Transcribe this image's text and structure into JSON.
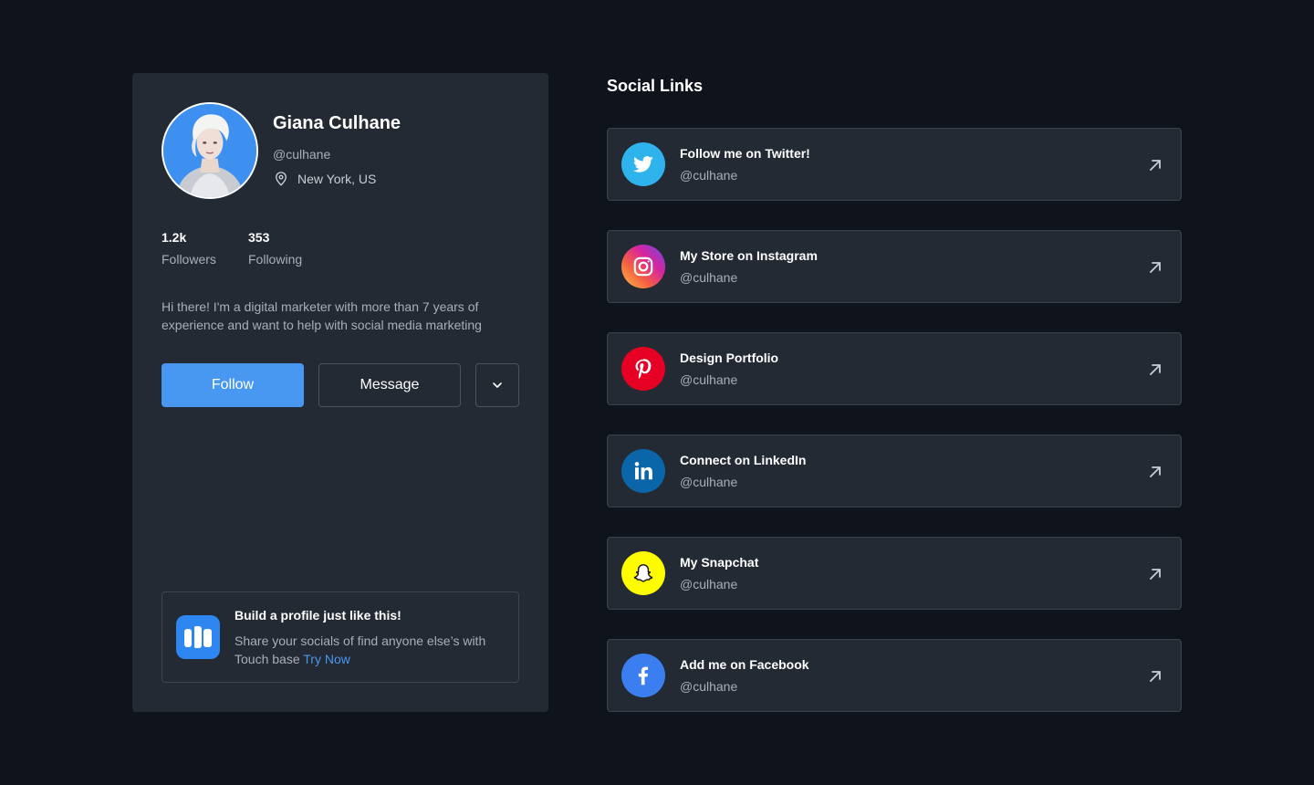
{
  "profile": {
    "name": "Giana Culhane",
    "handle": "@culhane",
    "location": "New York, US",
    "stats": [
      {
        "value": "1.2k",
        "label": "Followers"
      },
      {
        "value": "353",
        "label": "Following"
      }
    ],
    "bio": "Hi there! I'm a digital marketer with more than 7 years of experience and want to help with social media marketing",
    "follow_label": "Follow",
    "message_label": "Message"
  },
  "promo": {
    "title": "Build a profile just like this!",
    "text": "Share your socials of find anyone  else’s with Touch base ",
    "link": "Try Now"
  },
  "social": {
    "title": "Social Links",
    "links": [
      {
        "title": "Follow me on Twitter!",
        "handle": "@culhane",
        "icon": "twitter-icon",
        "color": "#1da1f2"
      },
      {
        "title": "My Store on Instagram",
        "handle": "@culhane",
        "icon": "instagram-icon",
        "color": "#e1306c"
      },
      {
        "title": "Design Portfolio",
        "handle": "@culhane",
        "icon": "pinterest-icon",
        "color": "#e60023"
      },
      {
        "title": "Connect on LinkedIn",
        "handle": "@culhane",
        "icon": "linkedin-icon",
        "color": "#0a66c2"
      },
      {
        "title": "My Snapchat",
        "handle": "@culhane",
        "icon": "snapchat-icon",
        "color": "#fffc00"
      },
      {
        "title": "Add me on Facebook",
        "handle": "@culhane",
        "icon": "facebook-icon",
        "color": "#1877f2"
      }
    ]
  },
  "colors": {
    "background": "#0f141c",
    "card": "#232a33",
    "accent": "#4897f0"
  }
}
